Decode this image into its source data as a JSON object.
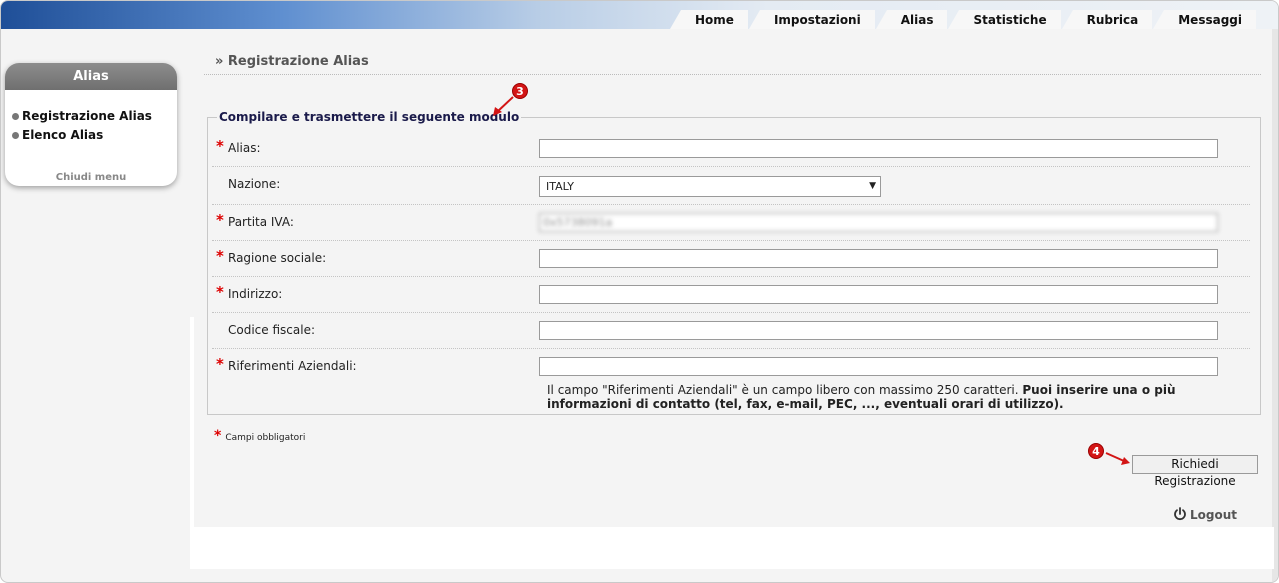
{
  "nav": {
    "tabs": [
      {
        "label": "Home"
      },
      {
        "label": "Impostazioni"
      },
      {
        "label": "Alias"
      },
      {
        "label": "Statistiche"
      },
      {
        "label": "Rubrica"
      },
      {
        "label": "Messaggi"
      }
    ]
  },
  "sidebar": {
    "title": "Alias",
    "items": [
      {
        "label": "Registrazione Alias"
      },
      {
        "label": "Elenco Alias"
      }
    ],
    "close_label": "Chiudi menu"
  },
  "page": {
    "title": "» Registrazione Alias",
    "legend": "Compilare e trasmettere il seguente modulo"
  },
  "form": {
    "required_mark": "*",
    "fields": [
      {
        "label": "Alias:",
        "value": ""
      },
      {
        "label": "Nazione:",
        "value": "ITALY"
      },
      {
        "label": "Partita IVA:",
        "value": "0x5738091a"
      },
      {
        "label": "Ragione sociale:",
        "value": ""
      },
      {
        "label": "Indirizzo:",
        "value": ""
      },
      {
        "label": "Codice fiscale:",
        "value": ""
      },
      {
        "label": "Riferimenti Aziendali:",
        "value": ""
      }
    ],
    "note_plain": "Il campo \"Riferimenti Aziendali\" è un campo libero con massimo 250 caratteri.",
    "note_bold": "Puoi inserire una o più informazioni di contatto (tel, fax, e-mail, PEC, ..., eventuali orari di utilizzo).",
    "required_note": "Campi obbligatori",
    "submit_label": "Richiedi Registrazione"
  },
  "footer": {
    "logout_label": "Logout"
  },
  "annotations": {
    "step3": "3",
    "step4": "4"
  },
  "colors": {
    "required": "#d00000",
    "callout": "#d31515"
  }
}
